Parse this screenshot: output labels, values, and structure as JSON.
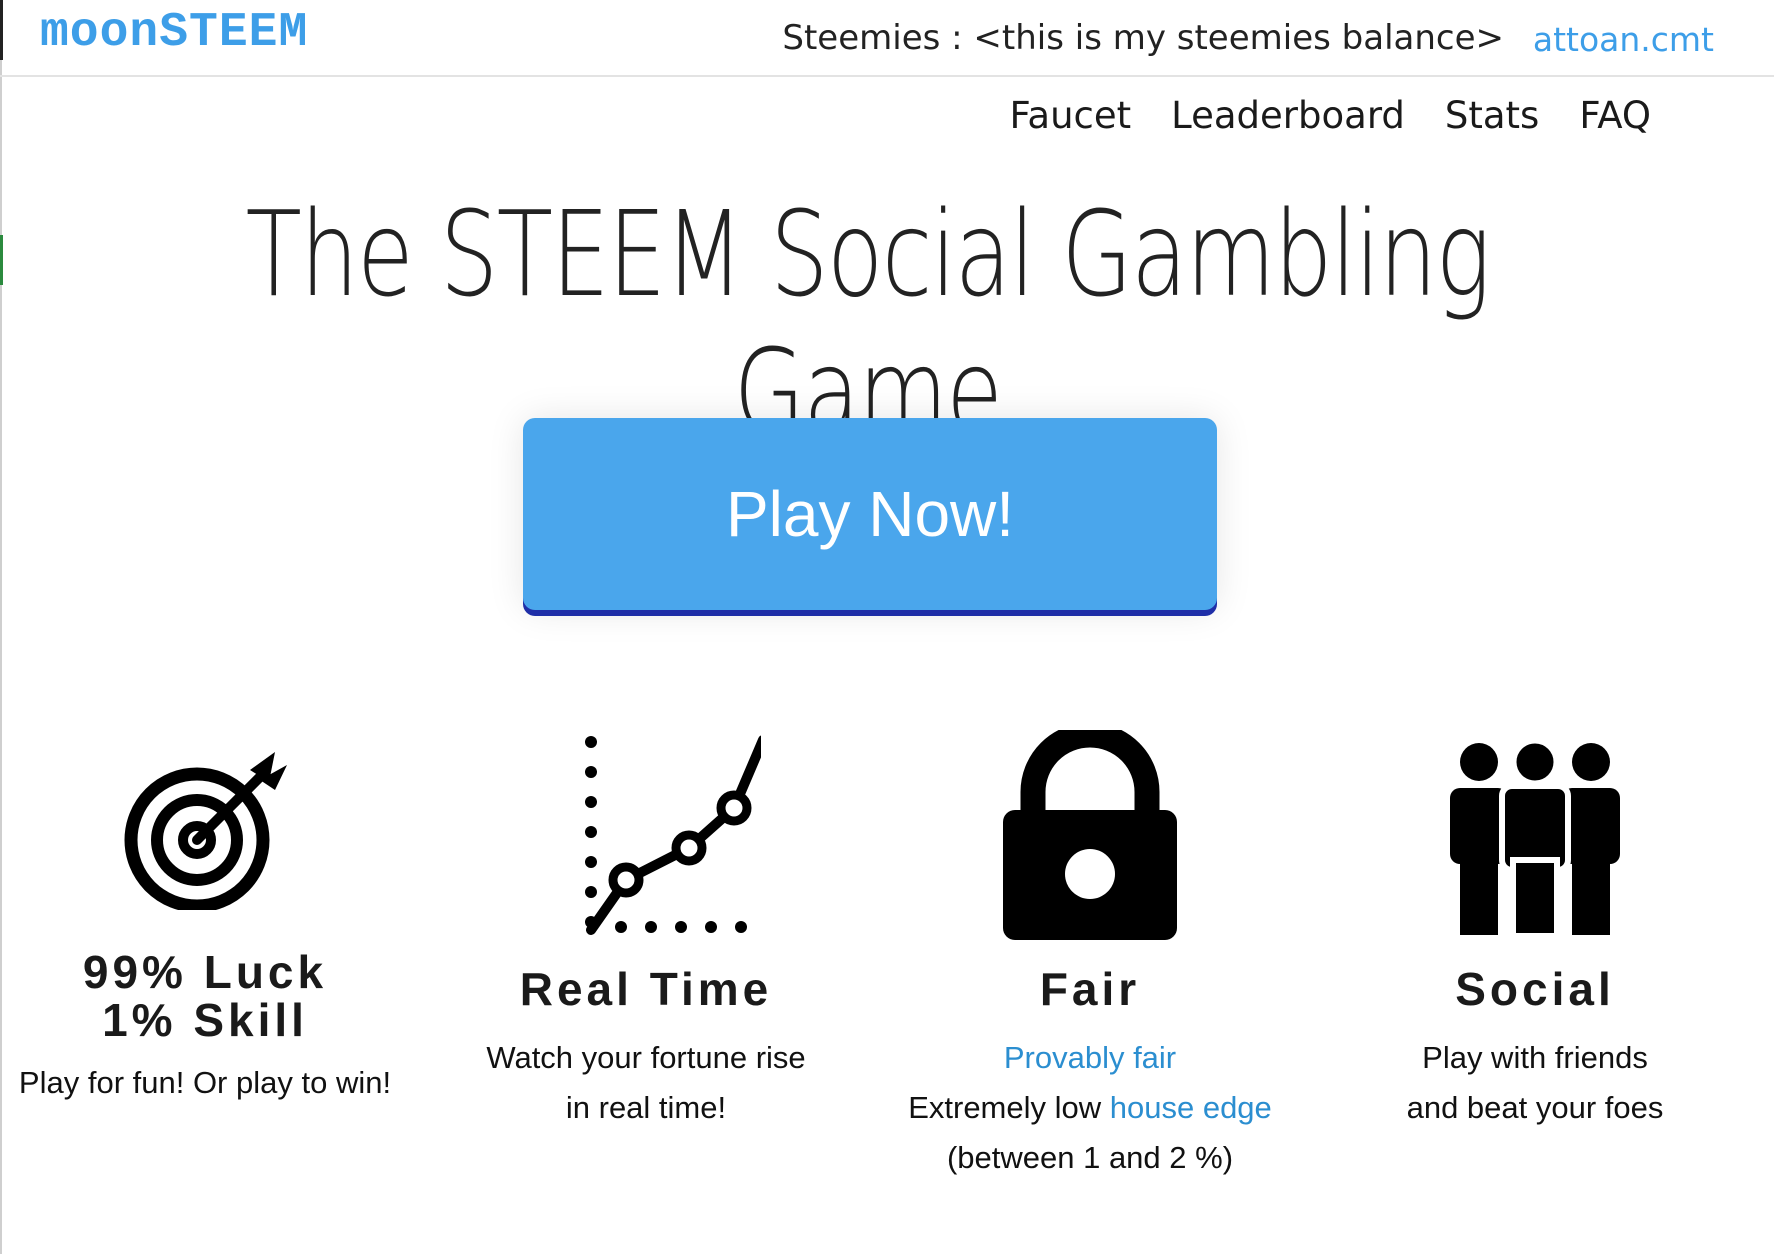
{
  "header": {
    "brand": "moonSTEEM",
    "balance_text": "Steemies : <this is my steemies balance>",
    "username": "attoan.cmt"
  },
  "nav": {
    "items": [
      "Faucet",
      "Leaderboard",
      "Stats",
      "FAQ"
    ]
  },
  "hero": {
    "title": "The STEEM Social Gambling Game",
    "play_button": "Play Now!"
  },
  "features": [
    {
      "icon": "target-icon",
      "title": "99% Luck\n1% Skill",
      "lines": [
        "Play for fun! Or play to win!"
      ]
    },
    {
      "icon": "line-chart-icon",
      "title": "Real Time",
      "lines": [
        "Watch your fortune rise",
        "in real time!"
      ]
    },
    {
      "icon": "padlock-icon",
      "title": "Fair",
      "link1": "Provably fair",
      "line2_prefix": "Extremely low ",
      "link2": "house edge",
      "line3": "(between 1 and 2 %)"
    },
    {
      "icon": "group-icon",
      "title": "Social",
      "lines": [
        "Play with friends",
        "and beat your foes"
      ]
    }
  ],
  "colors": {
    "accent": "#3d9ee8",
    "button": "#4aa6ec",
    "button_shadow": "#1f2fa8",
    "link": "#2b8ed0"
  }
}
